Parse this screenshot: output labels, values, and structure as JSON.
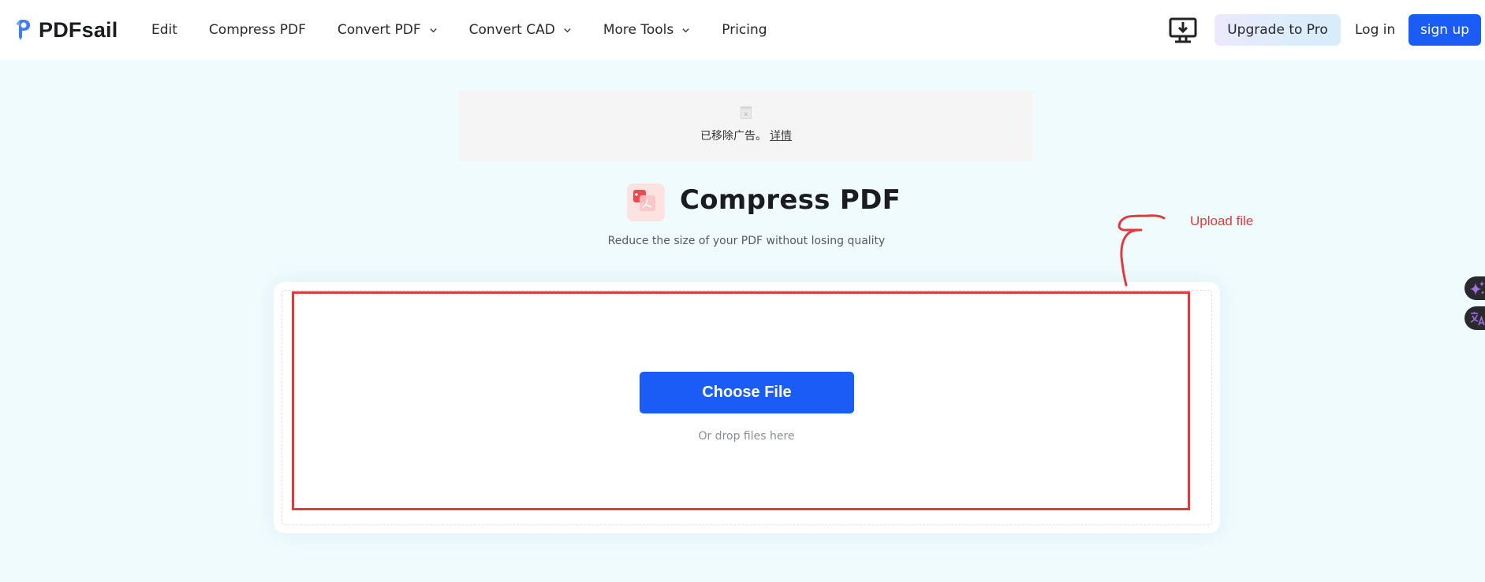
{
  "header": {
    "logo_text": "PDFsail",
    "nav": [
      {
        "label": "Edit",
        "has_dropdown": false
      },
      {
        "label": "Compress PDF",
        "has_dropdown": false
      },
      {
        "label": "Convert PDF",
        "has_dropdown": true
      },
      {
        "label": "Convert CAD",
        "has_dropdown": true
      },
      {
        "label": "More Tools",
        "has_dropdown": true
      },
      {
        "label": "Pricing",
        "has_dropdown": false
      }
    ],
    "desktop_icon": "desktop-download-icon",
    "upgrade_label": "Upgrade to Pro",
    "login_label": "Log in",
    "signup_label": "sign up"
  },
  "ad": {
    "removed_text": "已移除广告。",
    "details_link": "详情"
  },
  "tool": {
    "title": "Compress PDF",
    "subtitle": "Reduce the size of your PDF without losing quality",
    "choose_label": "Choose File",
    "drop_hint": "Or drop files here"
  },
  "annotation": {
    "label": "Upload file",
    "color": "#e03a3e"
  },
  "side_buttons": [
    {
      "icon": "sparkle-icon"
    },
    {
      "icon": "translate-icon"
    }
  ],
  "colors": {
    "primary": "#1a5cf5",
    "background": "#f0fbfd",
    "annotation": "#e03a3e"
  }
}
